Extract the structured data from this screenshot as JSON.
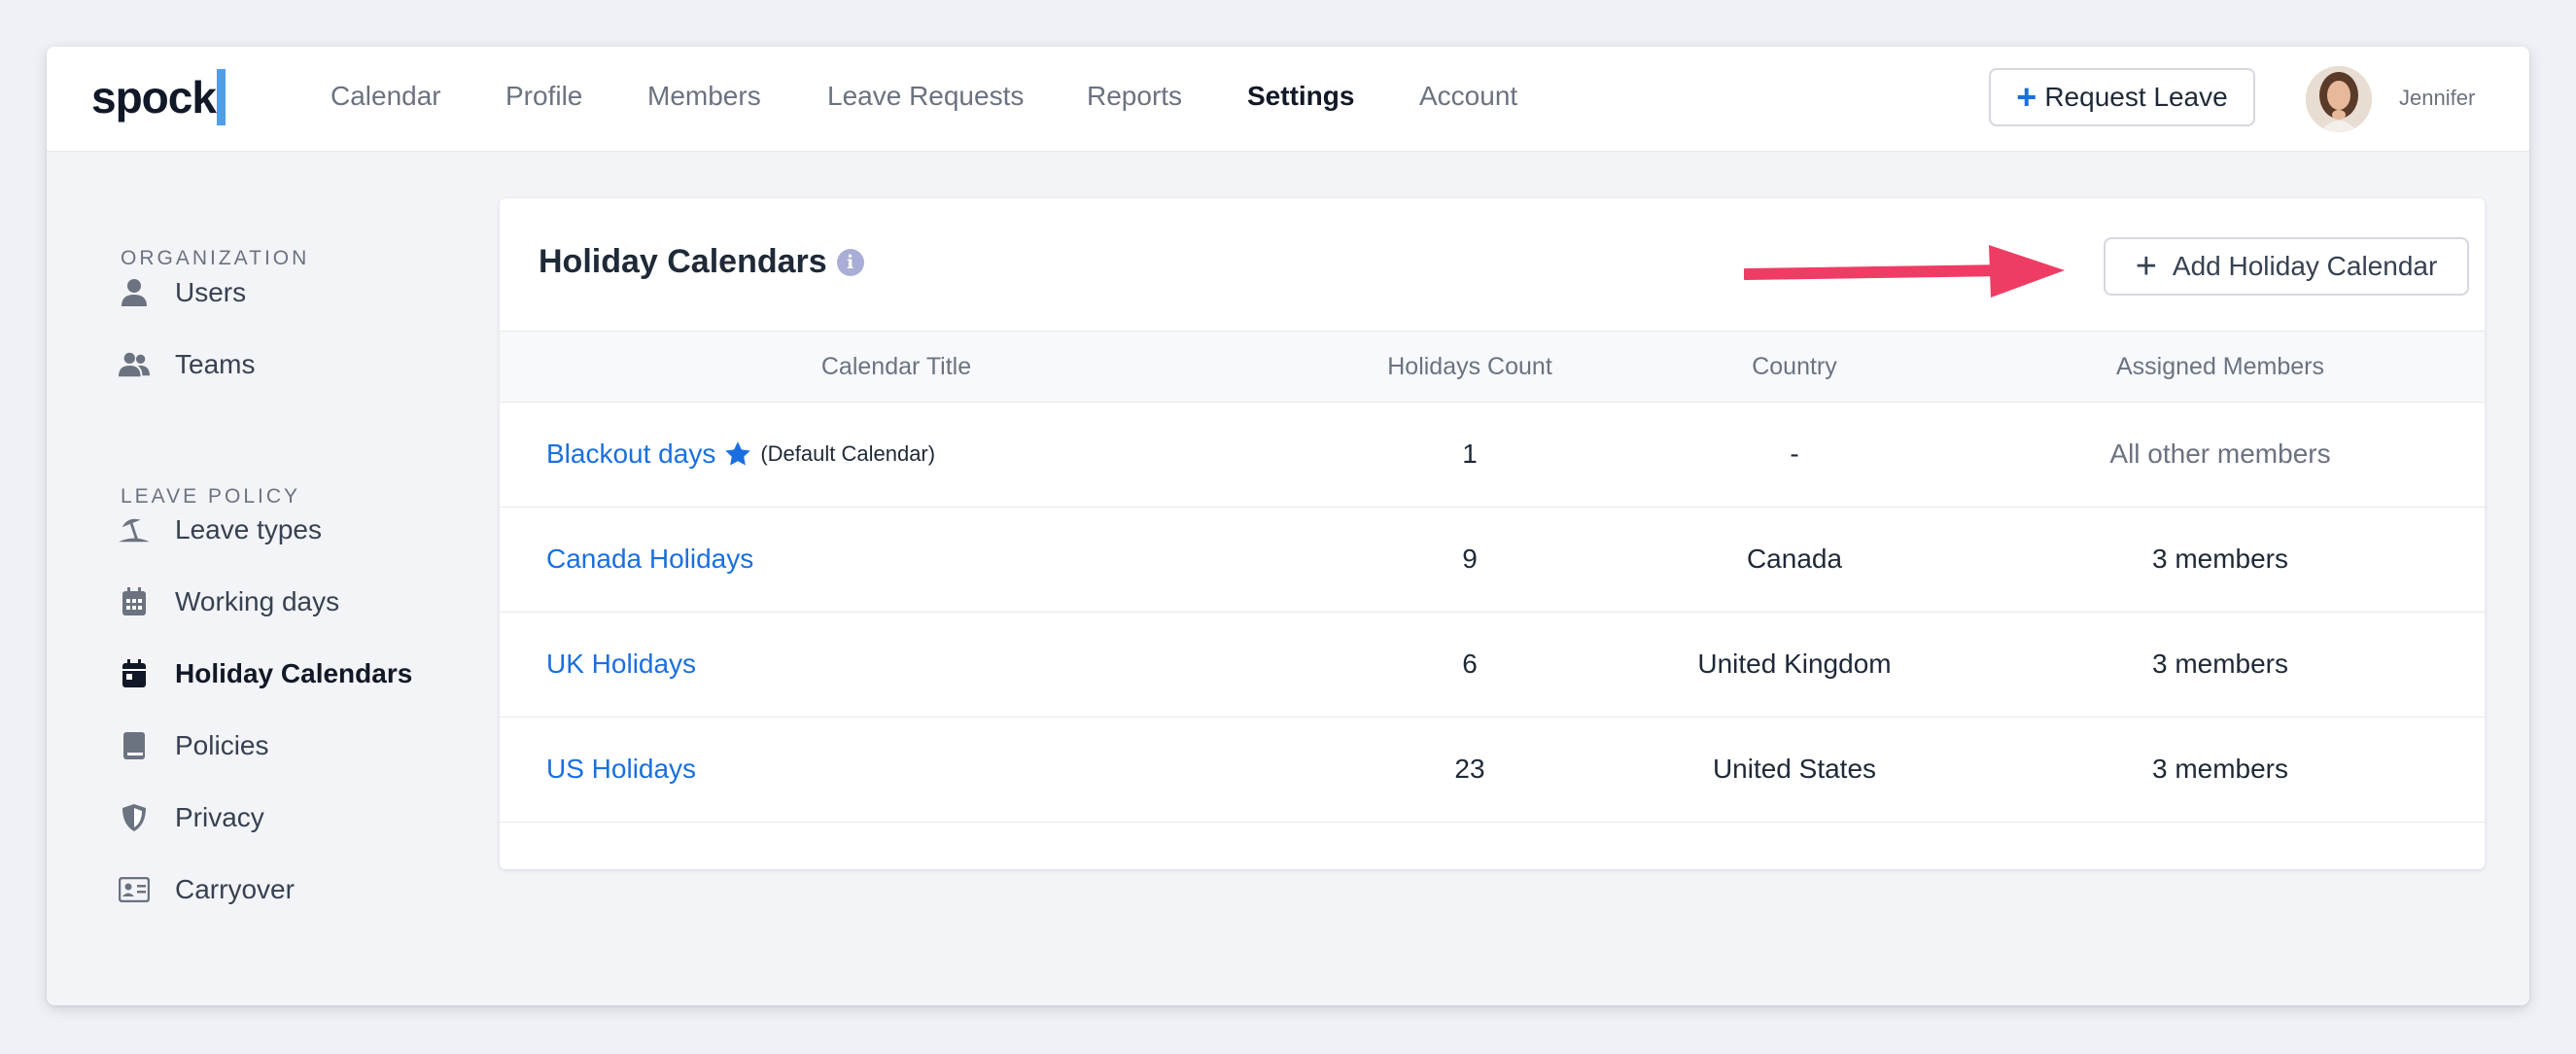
{
  "app": {
    "logo_text": "spock",
    "accent_color": "#4f9ee8",
    "link_color": "#1a6fe0"
  },
  "nav": {
    "items": [
      {
        "label": "Calendar",
        "active": false
      },
      {
        "label": "Profile",
        "active": false
      },
      {
        "label": "Members",
        "active": false
      },
      {
        "label": "Leave Requests",
        "active": false
      },
      {
        "label": "Reports",
        "active": false
      },
      {
        "label": "Settings",
        "active": true
      },
      {
        "label": "Account",
        "active": false
      }
    ],
    "request_leave_label": "Request Leave",
    "user_name": "Jennifer"
  },
  "sidebar": {
    "sections": [
      {
        "title": "ORGANIZATION",
        "items": [
          {
            "label": "Users",
            "icon": "user-icon"
          },
          {
            "label": "Teams",
            "icon": "users-icon"
          }
        ]
      },
      {
        "title": "LEAVE POLICY",
        "items": [
          {
            "label": "Leave types",
            "icon": "umbrella-beach-icon"
          },
          {
            "label": "Working days",
            "icon": "calendar-grid-icon"
          },
          {
            "label": "Holiday Calendars",
            "icon": "calendar-day-icon",
            "active": true
          },
          {
            "label": "Policies",
            "icon": "book-icon"
          },
          {
            "label": "Privacy",
            "icon": "shield-icon"
          },
          {
            "label": "Carryover",
            "icon": "id-card-icon"
          }
        ]
      }
    ]
  },
  "main": {
    "title": "Holiday Calendars",
    "info_glyph": "i",
    "add_button_label": "Add Holiday Calendar",
    "table": {
      "columns": [
        "Calendar Title",
        "Holidays Count",
        "Country",
        "Assigned Members"
      ],
      "rows": [
        {
          "title": "Blackout days",
          "is_default": true,
          "default_label": "(Default Calendar)",
          "count": "1",
          "country": "-",
          "members": "All other members"
        },
        {
          "title": "Canada Holidays",
          "is_default": false,
          "count": "9",
          "country": "Canada",
          "members": "3 members"
        },
        {
          "title": "UK Holidays",
          "is_default": false,
          "count": "6",
          "country": "United Kingdom",
          "members": "3 members"
        },
        {
          "title": "US Holidays",
          "is_default": false,
          "count": "23",
          "country": "United States",
          "members": "3 members"
        }
      ]
    }
  }
}
